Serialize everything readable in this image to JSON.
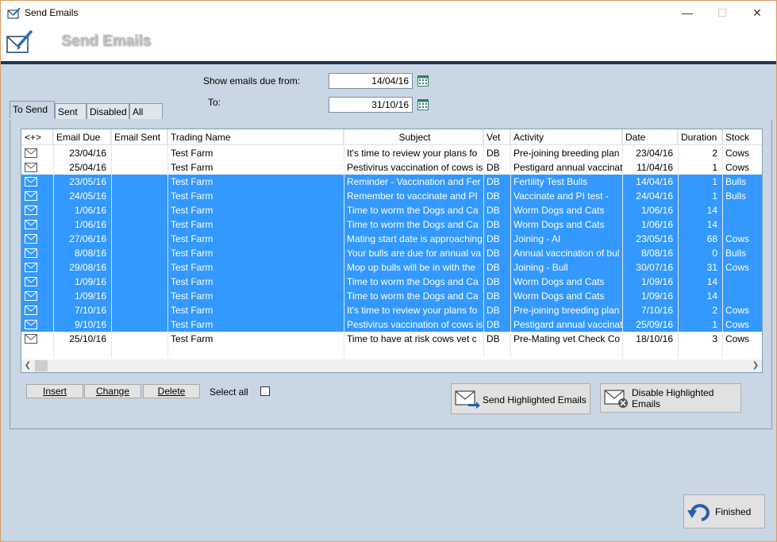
{
  "window": {
    "title": "Send Emails"
  },
  "header": {
    "title": "Send Emails"
  },
  "filters": {
    "from_label": "Show emails due from:",
    "from_value": "14/04/16",
    "to_label": "To:",
    "to_value": "31/10/16"
  },
  "tabs": [
    "To Send",
    "Sent",
    "Disabled",
    "All"
  ],
  "columns": [
    "<+>",
    "Email Due",
    "Email Sent",
    "Trading Name",
    "Subject",
    "Vet",
    "Activity",
    "Date",
    "Duration",
    "Stock"
  ],
  "rows": [
    {
      "due": "23/04/16",
      "sent": "",
      "trading": "Test Farm",
      "subject": "It's time to review your plans fo",
      "vet": "DB",
      "activity": "Pre-joining breeding plan",
      "date": "23/04/16",
      "duration": "2",
      "stock": "Cows",
      "selected": false
    },
    {
      "due": "25/04/16",
      "sent": "",
      "trading": "Test Farm",
      "subject": "Pestivirus vaccination of cows is",
      "vet": "DB",
      "activity": "Pestigard annual vaccinat",
      "date": "11/04/16",
      "duration": "1",
      "stock": "Cows",
      "selected": false
    },
    {
      "due": "23/05/16",
      "sent": "",
      "trading": "Test Farm",
      "subject": "Reminder -  Vaccination and Fer",
      "vet": "DB",
      "activity": "Fertility Test  Bulls",
      "date": "14/04/16",
      "duration": "1",
      "stock": "Bulls",
      "selected": true
    },
    {
      "due": "24/05/16",
      "sent": "",
      "trading": "Test Farm",
      "subject": "Remember to vaccinate and PI",
      "vet": "DB",
      "activity": "Vaccinate and PI test  - ",
      "date": "24/04/16",
      "duration": "1",
      "stock": "Bulls",
      "selected": true
    },
    {
      "due": "1/06/16",
      "sent": "",
      "trading": "Test Farm",
      "subject": "Time to worm the Dogs and Ca",
      "vet": "DB",
      "activity": "Worm Dogs and Cats",
      "date": "1/06/16",
      "duration": "14",
      "stock": "",
      "selected": true
    },
    {
      "due": "1/06/16",
      "sent": "",
      "trading": "Test Farm",
      "subject": "Time to worm the Dogs and Ca",
      "vet": "DB",
      "activity": "Worm Dogs and Cats",
      "date": "1/06/16",
      "duration": "14",
      "stock": "",
      "selected": true
    },
    {
      "due": "27/06/16",
      "sent": "",
      "trading": "Test Farm",
      "subject": "Mating start date is approaching",
      "vet": "DB",
      "activity": "Joining - AI",
      "date": "23/05/16",
      "duration": "68",
      "stock": "Cows",
      "selected": true
    },
    {
      "due": "8/08/16",
      "sent": "",
      "trading": "Test Farm",
      "subject": "Your bulls are due for annual va",
      "vet": "DB",
      "activity": "Annual vaccination of bul",
      "date": "8/08/16",
      "duration": "0",
      "stock": "Bulls",
      "selected": true
    },
    {
      "due": "29/08/16",
      "sent": "",
      "trading": "Test Farm",
      "subject": "Mop up bulls will be in with the",
      "vet": "DB",
      "activity": "Joining - Bull",
      "date": "30/07/16",
      "duration": "31",
      "stock": "Cows",
      "selected": true
    },
    {
      "due": "1/09/16",
      "sent": "",
      "trading": "Test Farm",
      "subject": "Time to worm the Dogs and Ca",
      "vet": "DB",
      "activity": "Worm Dogs and Cats",
      "date": "1/09/16",
      "duration": "14",
      "stock": "",
      "selected": true
    },
    {
      "due": "1/09/16",
      "sent": "",
      "trading": "Test Farm",
      "subject": "Time to worm the Dogs and Ca",
      "vet": "DB",
      "activity": "Worm Dogs and Cats",
      "date": "1/09/16",
      "duration": "14",
      "stock": "",
      "selected": true
    },
    {
      "due": "7/10/16",
      "sent": "",
      "trading": "Test Farm",
      "subject": "It's time to review your plans fo",
      "vet": "DB",
      "activity": "Pre-joining breeding plan",
      "date": "7/10/16",
      "duration": "2",
      "stock": "Cows",
      "selected": true
    },
    {
      "due": "9/10/16",
      "sent": "",
      "trading": "Test Farm",
      "subject": "Pestivirus vaccination of cows is",
      "vet": "DB",
      "activity": "Pestigard annual vaccinat",
      "date": "25/09/16",
      "duration": "1",
      "stock": "Cows",
      "selected": true
    },
    {
      "due": "25/10/16",
      "sent": "",
      "trading": "Test Farm",
      "subject": "Time to have at risk cows vet c",
      "vet": "DB",
      "activity": "Pre-Mating vet Check Co",
      "date": "18/10/16",
      "duration": "3",
      "stock": "Cows",
      "selected": false
    }
  ],
  "buttons": {
    "insert": "Insert",
    "change": "Change",
    "delete": "Delete",
    "select_all": "Select all",
    "send": "Send Highlighted Emails",
    "disable_line1": "Disable Highlighted",
    "disable_line2": "Emails",
    "finished": "Finished"
  },
  "colors": {
    "selection": "#3399ff",
    "body_bg": "#c9d6e3",
    "header_bar": "#1d3557"
  }
}
